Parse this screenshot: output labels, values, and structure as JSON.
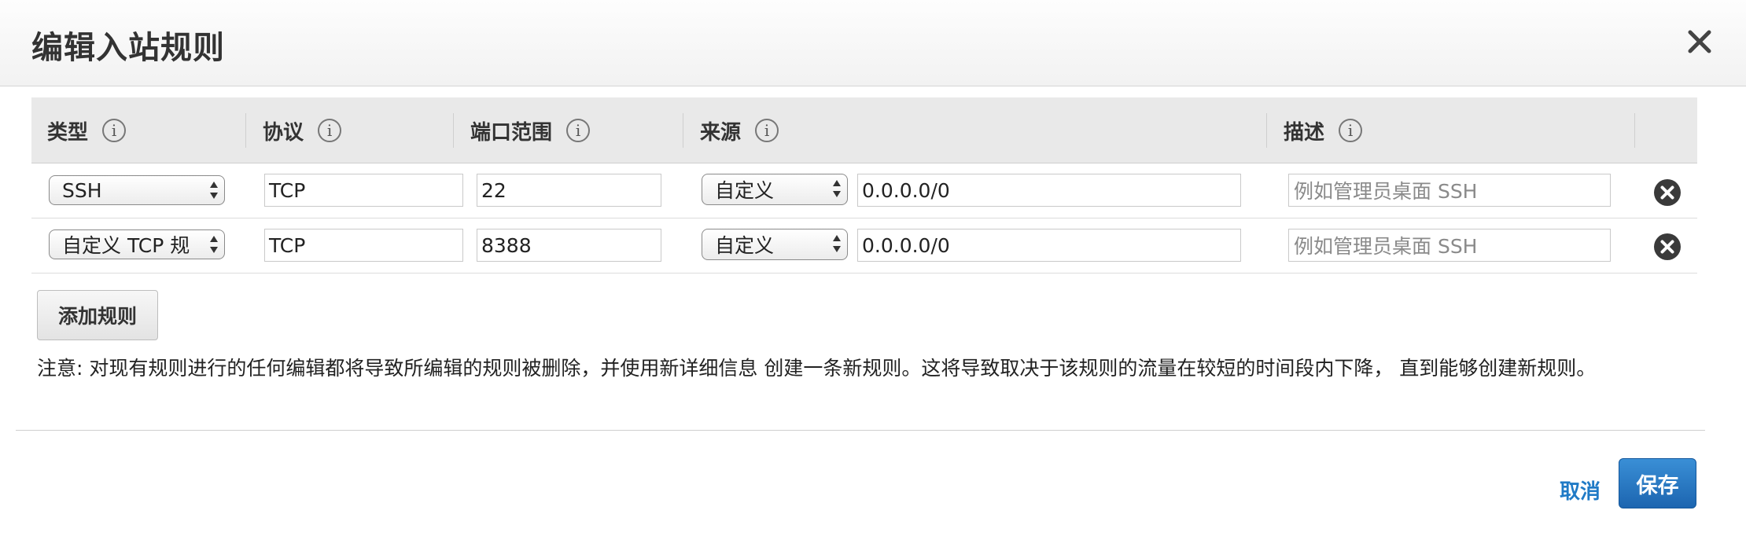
{
  "dialog": {
    "title": "编辑入站规则"
  },
  "table": {
    "headers": {
      "type": "类型",
      "protocol": "协议",
      "port_range": "端口范围",
      "source": "来源",
      "description": "描述"
    },
    "info_glyph": "i",
    "rows": [
      {
        "type": "SSH",
        "protocol": "TCP",
        "port_range": "22",
        "source_mode": "自定义",
        "source_cidr": "0.0.0.0/0",
        "description_placeholder": "例如管理员桌面 SSH"
      },
      {
        "type": "自定义 TCP 规",
        "protocol": "TCP",
        "port_range": "8388",
        "source_mode": "自定义",
        "source_cidr": "0.0.0.0/0",
        "description_placeholder": "例如管理员桌面 SSH"
      }
    ]
  },
  "actions": {
    "add_rule": "添加规则",
    "cancel": "取消",
    "save": "保存"
  },
  "note": {
    "text": "注意: 对现有规则进行的任何编辑都将导致所编辑的规则被删除，并使用新详细信息 创建一条新规则。这将导致取决于该规则的流量在较短的时间段内下降， 直到能够创建新规则。"
  },
  "icons": {
    "close": "close-icon",
    "info": "info-icon",
    "remove": "remove-circle-icon",
    "select_arrows": "updown-arrows-icon"
  },
  "colors": {
    "primary_button": "#2673be",
    "link": "#1f7ac6",
    "header_bg": "#e9e9e9"
  }
}
